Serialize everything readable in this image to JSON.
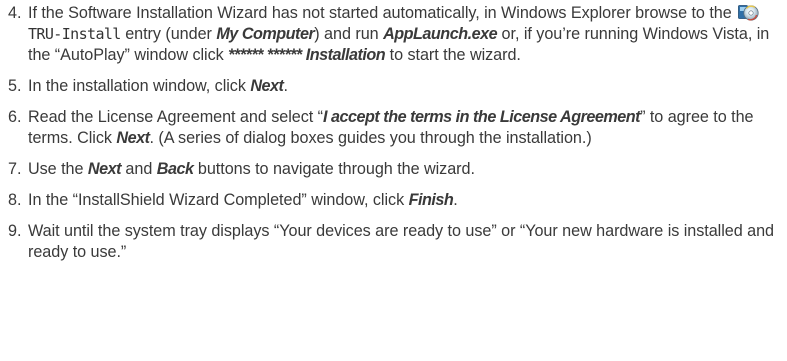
{
  "steps": [
    {
      "number": "4.",
      "parts": [
        {
          "t": "If the Software Installation Wizard has not started automatically, in Windows Explorer browse to the "
        },
        {
          "icon": "tru-install-cd-icon"
        },
        {
          "t": "TRU-Install",
          "s": "label"
        },
        {
          "t": " entry (under "
        },
        {
          "t": "My Computer",
          "s": "em"
        },
        {
          "t": ") and run "
        },
        {
          "t": "AppLaunch.exe",
          "s": "em"
        },
        {
          "t": " or, if you’re running Windows Vista, in the “AutoPlay” window click "
        },
        {
          "t": "****** ****** Installation",
          "s": "em"
        },
        {
          "t": " to start the wizard."
        }
      ]
    },
    {
      "number": "5.",
      "parts": [
        {
          "t": "In the installation window, click "
        },
        {
          "t": "Next",
          "s": "em"
        },
        {
          "t": "."
        }
      ]
    },
    {
      "number": "6.",
      "parts": [
        {
          "t": "Read the License Agreement and select “"
        },
        {
          "t": "I accept the terms in the License Agreement",
          "s": "em"
        },
        {
          "t": "” to agree to the terms. Click "
        },
        {
          "t": "Next",
          "s": "em"
        },
        {
          "t": ". (A series of dialog boxes guides you through the installation.)"
        }
      ]
    },
    {
      "number": "7.",
      "parts": [
        {
          "t": "Use the "
        },
        {
          "t": "Next",
          "s": "em"
        },
        {
          "t": " and "
        },
        {
          "t": "Back",
          "s": "em"
        },
        {
          "t": " buttons to navigate through the wizard."
        }
      ]
    },
    {
      "number": "8.",
      "parts": [
        {
          "t": "In the “InstallShield Wizard Completed” window, click "
        },
        {
          "t": "Finish",
          "s": "em"
        },
        {
          "t": "."
        }
      ]
    },
    {
      "number": "9.",
      "parts": [
        {
          "t": "Wait until the system tray displays “Your devices are ready to use” or “Your new hardware is installed and ready to use.”"
        }
      ]
    }
  ]
}
